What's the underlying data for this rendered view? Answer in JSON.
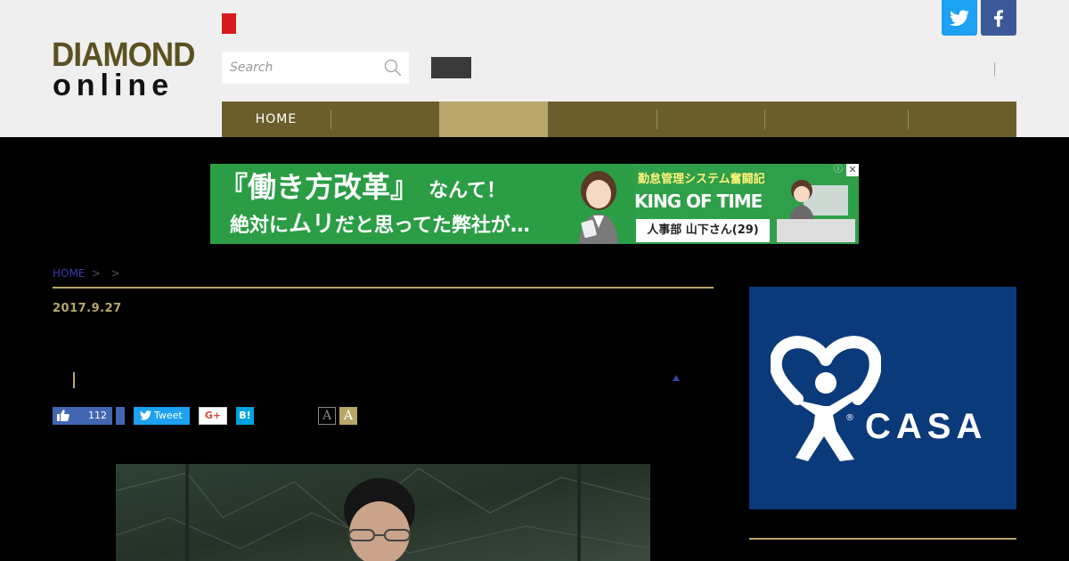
{
  "header": {
    "logo_line1": "DIAMOND",
    "logo_line2": "online",
    "search_placeholder": "Search",
    "social": {
      "twitter_icon": "twitter-icon",
      "facebook_icon": "facebook-icon"
    }
  },
  "nav": {
    "items": [
      {
        "label": "HOME",
        "active": false
      },
      {
        "label": "",
        "active": false
      },
      {
        "label": "",
        "active": true
      },
      {
        "label": "",
        "active": false
      },
      {
        "label": "",
        "active": false
      },
      {
        "label": "",
        "active": false
      },
      {
        "label": "",
        "active": false
      }
    ]
  },
  "banner": {
    "headline": "『働き方改革』",
    "headline_suffix": "なんて！",
    "subline_a": "絶対に",
    "subline_b": "ムリ",
    "subline_c": "だと思ってた弊社が…",
    "product_caption": "勤怠管理システム奮闘記",
    "product_name": "KING OF TIME",
    "character_name": "人事部 山下さん(29)",
    "close_label": "✕",
    "info_label": "ⓘ"
  },
  "article": {
    "breadcrumb_home": "HOME",
    "breadcrumb_sep1": ">",
    "breadcrumb_sep2": ">",
    "date": "2017.9.27",
    "like_count": "112",
    "tweet_label": "Tweet",
    "gplus_label": "G+",
    "hatena_label": "B!",
    "font_small_label": "A",
    "font_large_label": "A"
  },
  "sidebar_ad": {
    "brand": "CASA",
    "reg_mark": "®"
  },
  "colors": {
    "accent_gold": "#b9a76a",
    "nav_bg": "#6b5e2c",
    "twitter": "#1da1f2",
    "facebook": "#3b5998",
    "casa_blue": "#0b3a7b"
  }
}
